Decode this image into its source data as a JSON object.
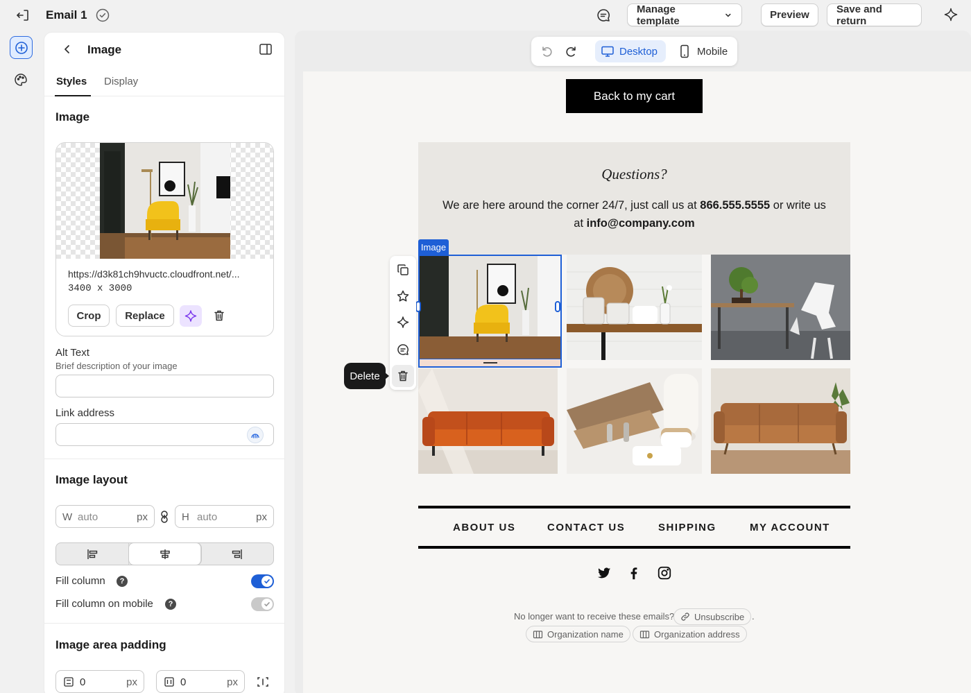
{
  "topbar": {
    "title": "Email 1",
    "manage_template": "Manage template",
    "preview": "Preview",
    "save_return": "Save and return"
  },
  "panel": {
    "title": "Image",
    "tabs": [
      {
        "label": "Styles",
        "active": true
      },
      {
        "label": "Display",
        "active": false
      }
    ],
    "image_section": {
      "title": "Image",
      "url": "https://d3k81ch9hvuctc.cloudfront.net/...",
      "dimensions": "3400 x 3000",
      "crop": "Crop",
      "replace": "Replace"
    },
    "alt_text": {
      "label": "Alt Text",
      "help": "Brief description of your image",
      "value": ""
    },
    "link_address": {
      "label": "Link address",
      "value": ""
    },
    "layout": {
      "title": "Image layout",
      "width_label": "W",
      "width_value": "auto",
      "height_label": "H",
      "height_value": "auto",
      "unit": "px",
      "alignment_options": [
        "left",
        "center",
        "right"
      ],
      "alignment_selected": "center",
      "fill_column": {
        "label": "Fill column",
        "help": "?",
        "on": true
      },
      "fill_column_mobile": {
        "label": "Fill column on mobile",
        "help": "?",
        "on": false
      }
    },
    "padding": {
      "title": "Image area padding",
      "vertical": "0",
      "horizontal": "0",
      "unit": "px"
    }
  },
  "canvas_toolbar": {
    "desktop": "Desktop",
    "mobile": "Mobile",
    "selected": "desktop"
  },
  "email": {
    "cart_button": "Back to my cart",
    "questions_title": "Questions?",
    "questions_text_1": "We are here around the corner 24/7, just call us at ",
    "phone": "866.555.5555",
    "questions_text_2": " or write us at ",
    "email_address": "info@company.com",
    "selected_block_label": "Image",
    "delete_tooltip": "Delete",
    "grid_images": [
      "yellow-armchair",
      "kitchen-shelf",
      "bonsai-dining-table",
      "orange-leather-sofa",
      "wooden-boards-ceramics",
      "tan-leather-sofa"
    ],
    "nav": [
      "ABOUT US",
      "CONTACT US",
      "SHIPPING",
      "MY ACCOUNT"
    ],
    "social": [
      "twitter-icon",
      "facebook-icon",
      "instagram-icon"
    ],
    "footer": {
      "unsubscribe_question": "No longer want to receive these emails?",
      "unsubscribe": "Unsubscribe",
      "period": ".",
      "org_name": "Organization name",
      "org_address": "Organization address"
    }
  },
  "colors": {
    "accent": "#1e5fd6",
    "cart_button_bg": "#000000",
    "questions_bg": "#e9e7e3",
    "email_bg": "#f7f6f4"
  }
}
